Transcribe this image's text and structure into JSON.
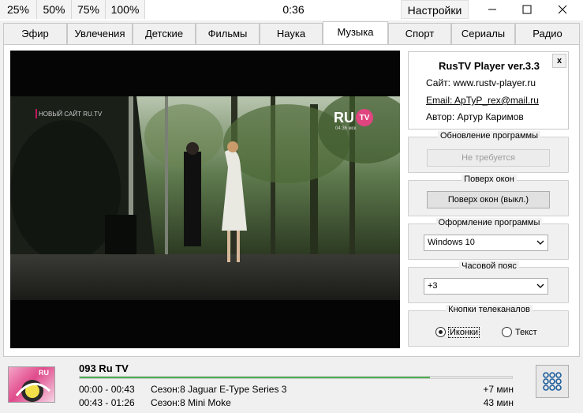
{
  "titlebar": {
    "zoom": [
      "25%",
      "50%",
      "75%",
      "100%"
    ],
    "timer": "0:36",
    "settings_label": "Настройки"
  },
  "tabs": [
    {
      "label": "Эфир",
      "active": false
    },
    {
      "label": "Увлечения",
      "active": false
    },
    {
      "label": "Детские",
      "active": false
    },
    {
      "label": "Фильмы",
      "active": false
    },
    {
      "label": "Наука",
      "active": false
    },
    {
      "label": "Музыка",
      "active": true
    },
    {
      "label": "Спорт",
      "active": false
    },
    {
      "label": "Сериалы",
      "active": false
    },
    {
      "label": "Радио",
      "active": false
    }
  ],
  "video": {
    "overlay_text": "НОВЫЙ САЙТ RU.TV",
    "logo_ru": "RU",
    "logo_tv": "TV",
    "logo_time": "04:36 мск"
  },
  "about": {
    "title": "RusTV Player ver.3.3",
    "site": "Сайт: www.rustv-player.ru",
    "email": "Email: ApTyP_rex@mail.ru",
    "author": "Автор: Артур Каримов",
    "close": "x"
  },
  "update": {
    "caption": "Обновление программы",
    "button": "Не требуется"
  },
  "ontop": {
    "caption": "Поверх окон",
    "button": "Поверх окон (выкл.)"
  },
  "theme": {
    "caption": "Оформление программы",
    "value": "Windows 10"
  },
  "timezone": {
    "caption": "Часовой пояс",
    "value": "+3"
  },
  "channel_buttons": {
    "caption": "Кнопки телеканалов",
    "options": [
      "Иконки",
      "Текст"
    ],
    "selected": 0
  },
  "now_playing": {
    "channel": "093   Ru TV",
    "progress": 0.81,
    "programs": [
      {
        "time": "00:00 - 00:43",
        "title": "Сезон:8 Jaguar E-Type Series 3",
        "duration": "+7 мин"
      },
      {
        "time": "00:43 - 01:26",
        "title": "Сезон:8 Mini Moke",
        "duration": "43 мин"
      }
    ]
  },
  "colors": {
    "accent_green": "#4caf50",
    "ru_tv_pink": "#e0457f"
  }
}
